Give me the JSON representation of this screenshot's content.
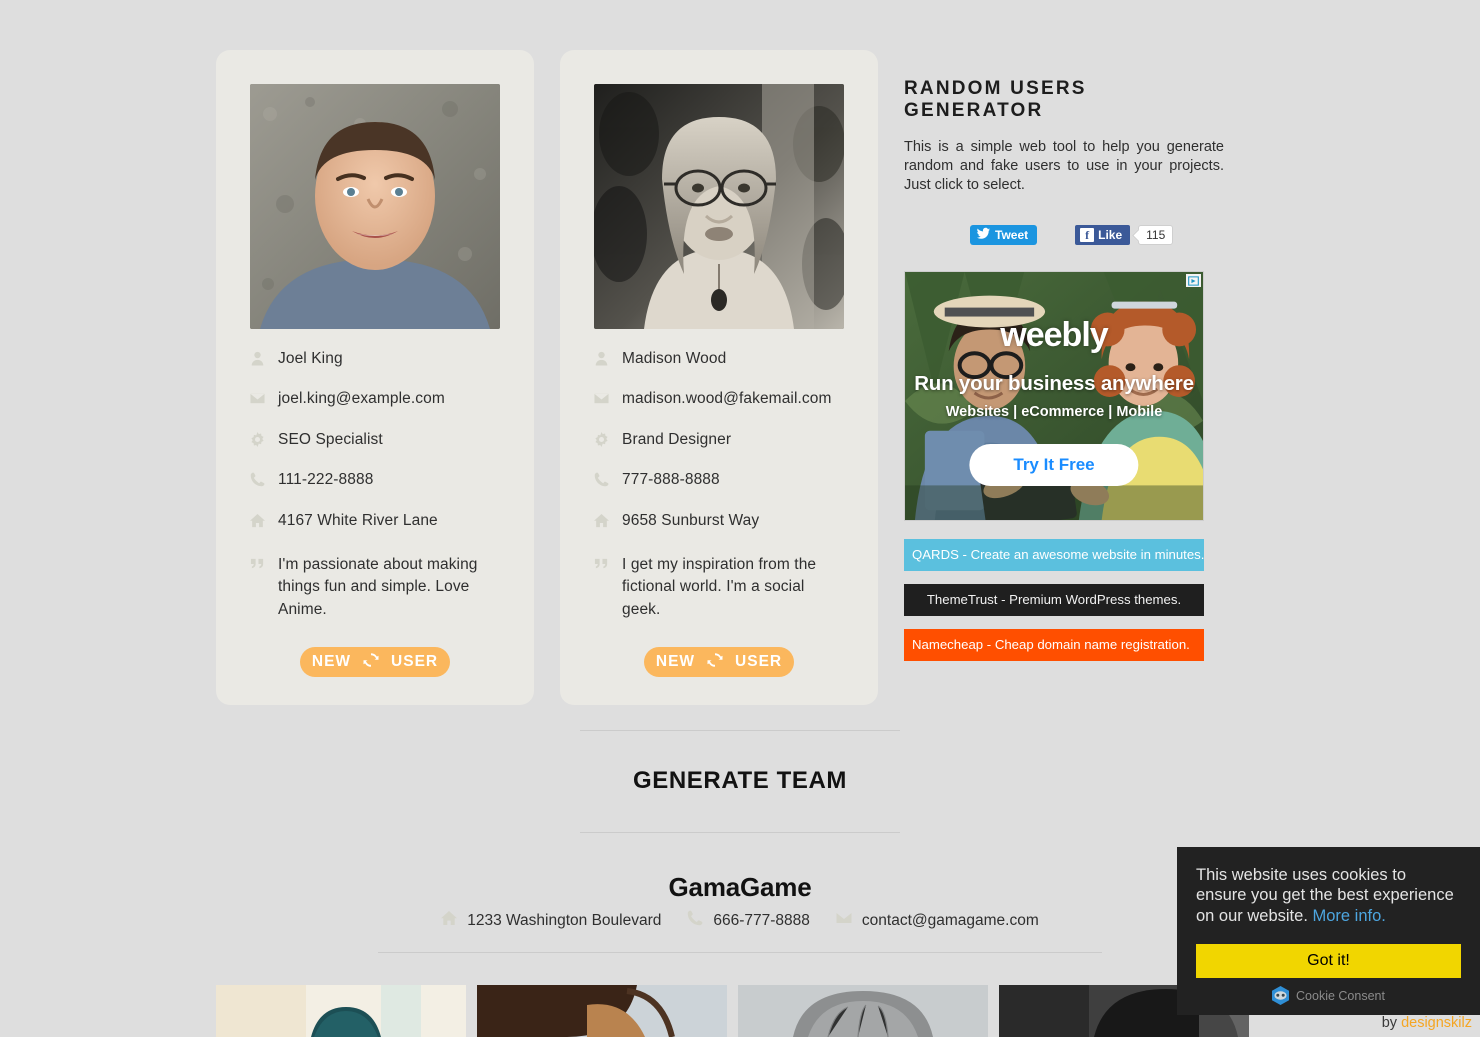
{
  "users": [
    {
      "name": "Joel King",
      "email": "joel.king@example.com",
      "job": "SEO Specialist",
      "phone": "111-222-8888",
      "address": "4167 White River Lane",
      "quote": "I'm passionate about making things fun and simple. Love Anime.",
      "button_new": "NEW",
      "button_user": "USER",
      "photo_alt": "portrait-man-gray-shirt"
    },
    {
      "name": "Madison Wood",
      "email": "madison.wood@fakemail.com",
      "job": "Brand Designer",
      "phone": "777-888-8888",
      "address": "9658 Sunburst Way",
      "quote": "I get my inspiration from the fictional world. I'm a social geek.",
      "button_new": "NEW",
      "button_user": "USER",
      "photo_alt": "portrait-woman-glasses-bw"
    }
  ],
  "sidebar": {
    "title": "RANDOM USERS GENERATOR",
    "description": "This is a simple web tool to help you generate random and fake users to use in your projects. Just click to select.",
    "tweet_label": "Tweet",
    "facebook_label": "Like",
    "facebook_letter": "f",
    "facebook_count": "115"
  },
  "ad": {
    "logo": "weebly",
    "headline": "Run your business anywhere",
    "subline": "Websites | eCommerce | Mobile",
    "cta": "Try It Free",
    "adchoices_label": "AdChoices"
  },
  "promos": [
    {
      "text": "QARDS - Create an awesome website in minutes.",
      "color": "#5bc0de"
    },
    {
      "text": "ThemeTrust - Premium WordPress themes.",
      "color": "#1f1f1f"
    },
    {
      "text": "Namecheap - Cheap domain name registration.",
      "color": "#ff4f00"
    }
  ],
  "team": {
    "section_heading": "GENERATE TEAM",
    "name": "GamaGame",
    "address": "1233 Washington Boulevard",
    "phone": "666-777-8888",
    "email": "contact@gamagame.com",
    "photos": [
      "team-photo-1-cap",
      "team-photo-2-brunette",
      "team-photo-3-gray-hair",
      "team-photo-4-bw"
    ]
  },
  "cookie": {
    "message": "This website uses cookies to ensure you get the best experience on our website.",
    "more_info": "More info.",
    "accept_label": "Got it!",
    "brand": "Cookie Consent"
  },
  "credit": {
    "prefix": "by",
    "link": "designskilz"
  },
  "colors": {
    "page_bg": "#dedede",
    "card_bg": "#eae9e4",
    "accent_orange": "#fbb75d",
    "icon_gray": "#d4d4ca",
    "cookie_bg": "#222222",
    "cookie_btn": "#f1d600",
    "credit_link": "#f5a623"
  }
}
